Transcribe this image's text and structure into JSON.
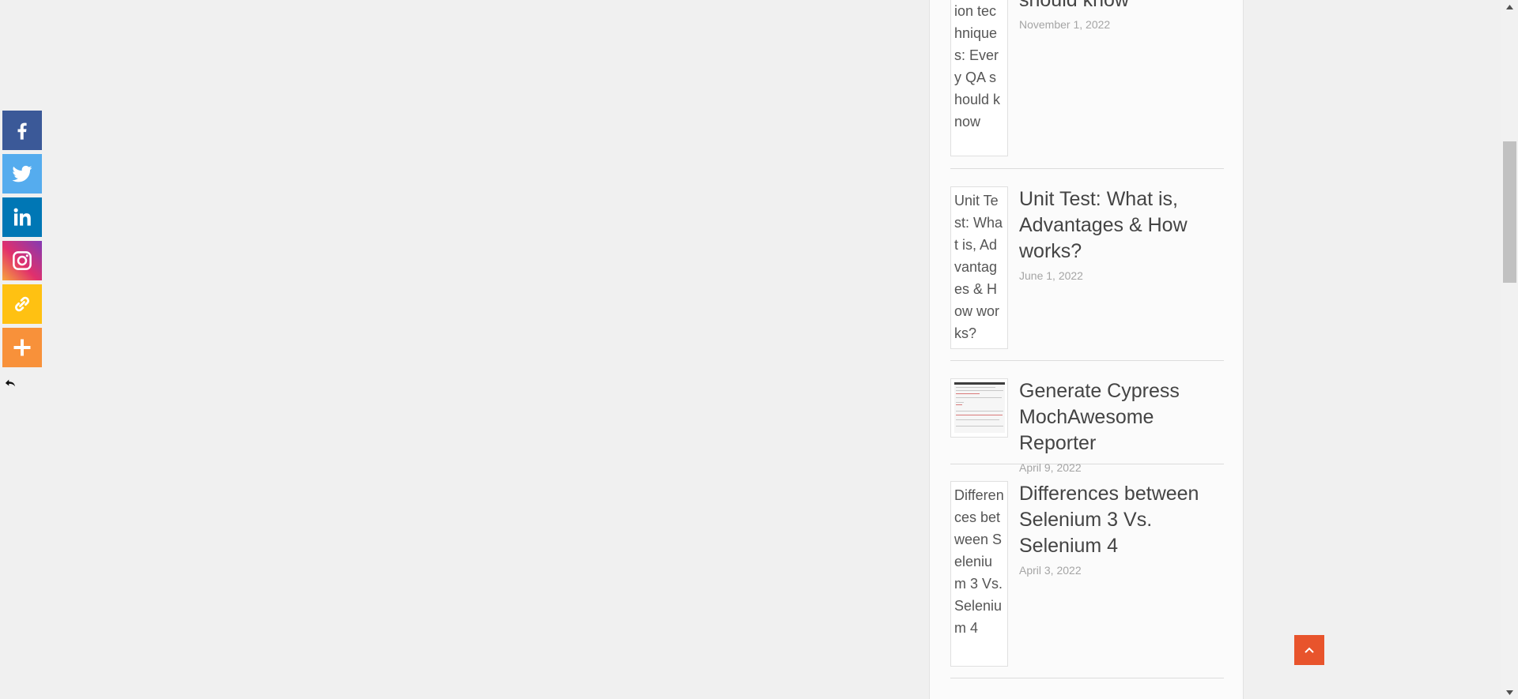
{
  "share_bar": {
    "buttons": [
      {
        "name": "facebook",
        "icon": "facebook-icon",
        "color": "#3b5998"
      },
      {
        "name": "twitter",
        "icon": "twitter-icon",
        "color": "#55acee"
      },
      {
        "name": "linkedin",
        "icon": "linkedin-icon",
        "color": "#0077b5"
      },
      {
        "name": "instagram",
        "icon": "instagram-icon",
        "color": "#c13584"
      },
      {
        "name": "copy-link",
        "icon": "link-icon",
        "color": "#ffc112"
      },
      {
        "name": "more",
        "icon": "plus-icon",
        "color": "#f8913a"
      }
    ],
    "hide_icon": "hide-arrow-icon"
  },
  "recent_posts": [
    {
      "thumb_alt": "ion techniques: Every QA should know",
      "title": "should know",
      "date": "November 1, 2022"
    },
    {
      "thumb_alt": "Unit Test: What is, Advantages & How works?",
      "title": "Unit Test: What is, Advantages & How works?",
      "date": "June 1, 2022"
    },
    {
      "thumb_alt": "",
      "title": "Generate Cypress MochAwesome Reporter",
      "date": "April 9, 2022"
    },
    {
      "thumb_alt": "Differences between Selenium 3 Vs. Selenium 4",
      "title": "Differences between Selenium 3 Vs. Selenium 4",
      "date": "April 3, 2022"
    }
  ],
  "back_to_top": {
    "icon": "chevron-up-icon",
    "color": "#e8542c"
  },
  "scrollbar": {
    "up_icon": "scroll-up-arrow-icon",
    "down_icon": "scroll-down-arrow-icon"
  }
}
